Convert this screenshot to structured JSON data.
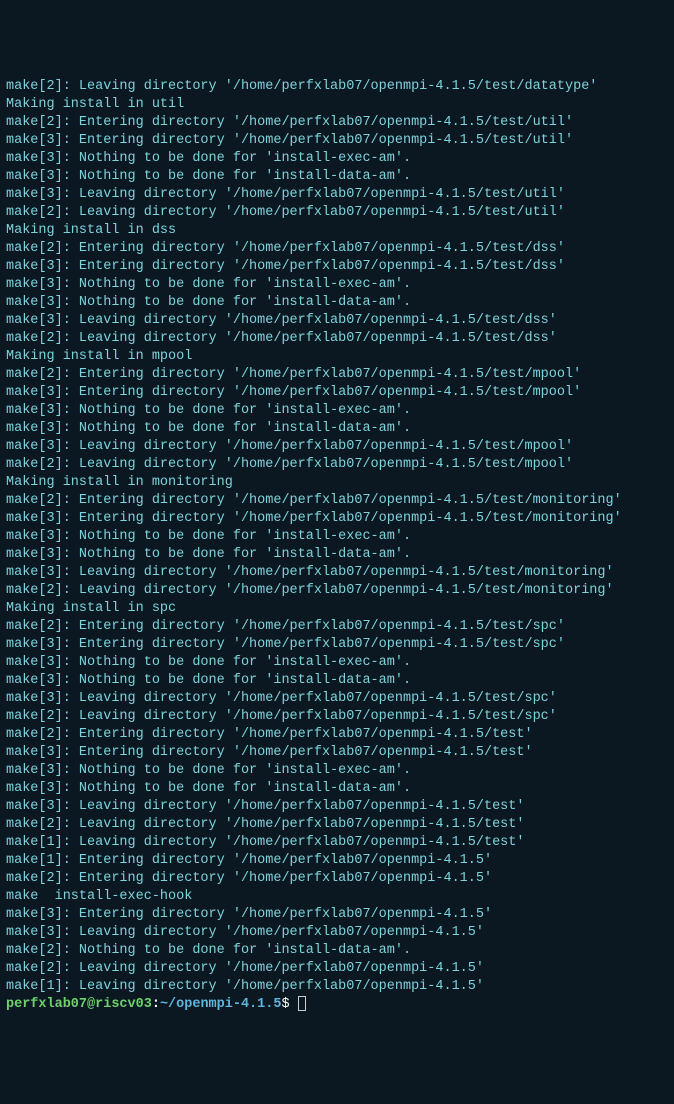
{
  "lines": [
    "make[2]: Leaving directory '/home/perfxlab07/openmpi-4.1.5/test/datatype'",
    "Making install in util",
    "make[2]: Entering directory '/home/perfxlab07/openmpi-4.1.5/test/util'",
    "make[3]: Entering directory '/home/perfxlab07/openmpi-4.1.5/test/util'",
    "make[3]: Nothing to be done for 'install-exec-am'.",
    "make[3]: Nothing to be done for 'install-data-am'.",
    "make[3]: Leaving directory '/home/perfxlab07/openmpi-4.1.5/test/util'",
    "make[2]: Leaving directory '/home/perfxlab07/openmpi-4.1.5/test/util'",
    "Making install in dss",
    "make[2]: Entering directory '/home/perfxlab07/openmpi-4.1.5/test/dss'",
    "make[3]: Entering directory '/home/perfxlab07/openmpi-4.1.5/test/dss'",
    "make[3]: Nothing to be done for 'install-exec-am'.",
    "make[3]: Nothing to be done for 'install-data-am'.",
    "make[3]: Leaving directory '/home/perfxlab07/openmpi-4.1.5/test/dss'",
    "make[2]: Leaving directory '/home/perfxlab07/openmpi-4.1.5/test/dss'",
    "Making install in mpool",
    "make[2]: Entering directory '/home/perfxlab07/openmpi-4.1.5/test/mpool'",
    "make[3]: Entering directory '/home/perfxlab07/openmpi-4.1.5/test/mpool'",
    "make[3]: Nothing to be done for 'install-exec-am'.",
    "make[3]: Nothing to be done for 'install-data-am'.",
    "make[3]: Leaving directory '/home/perfxlab07/openmpi-4.1.5/test/mpool'",
    "make[2]: Leaving directory '/home/perfxlab07/openmpi-4.1.5/test/mpool'",
    "Making install in monitoring",
    "make[2]: Entering directory '/home/perfxlab07/openmpi-4.1.5/test/monitoring'",
    "make[3]: Entering directory '/home/perfxlab07/openmpi-4.1.5/test/monitoring'",
    "make[3]: Nothing to be done for 'install-exec-am'.",
    "make[3]: Nothing to be done for 'install-data-am'.",
    "make[3]: Leaving directory '/home/perfxlab07/openmpi-4.1.5/test/monitoring'",
    "make[2]: Leaving directory '/home/perfxlab07/openmpi-4.1.5/test/monitoring'",
    "Making install in spc",
    "make[2]: Entering directory '/home/perfxlab07/openmpi-4.1.5/test/spc'",
    "make[3]: Entering directory '/home/perfxlab07/openmpi-4.1.5/test/spc'",
    "make[3]: Nothing to be done for 'install-exec-am'.",
    "make[3]: Nothing to be done for 'install-data-am'.",
    "make[3]: Leaving directory '/home/perfxlab07/openmpi-4.1.5/test/spc'",
    "make[2]: Leaving directory '/home/perfxlab07/openmpi-4.1.5/test/spc'",
    "make[2]: Entering directory '/home/perfxlab07/openmpi-4.1.5/test'",
    "make[3]: Entering directory '/home/perfxlab07/openmpi-4.1.5/test'",
    "make[3]: Nothing to be done for 'install-exec-am'.",
    "make[3]: Nothing to be done for 'install-data-am'.",
    "make[3]: Leaving directory '/home/perfxlab07/openmpi-4.1.5/test'",
    "make[2]: Leaving directory '/home/perfxlab07/openmpi-4.1.5/test'",
    "make[1]: Leaving directory '/home/perfxlab07/openmpi-4.1.5/test'",
    "make[1]: Entering directory '/home/perfxlab07/openmpi-4.1.5'",
    "make[2]: Entering directory '/home/perfxlab07/openmpi-4.1.5'",
    "make  install-exec-hook",
    "make[3]: Entering directory '/home/perfxlab07/openmpi-4.1.5'",
    "make[3]: Leaving directory '/home/perfxlab07/openmpi-4.1.5'",
    "make[2]: Nothing to be done for 'install-data-am'.",
    "make[2]: Leaving directory '/home/perfxlab07/openmpi-4.1.5'",
    "make[1]: Leaving directory '/home/perfxlab07/openmpi-4.1.5'"
  ],
  "prompt": {
    "user_host": "perfxlab07@riscv03",
    "colon": ":",
    "path": "~/openmpi-4.1.5",
    "dollar": "$ "
  }
}
